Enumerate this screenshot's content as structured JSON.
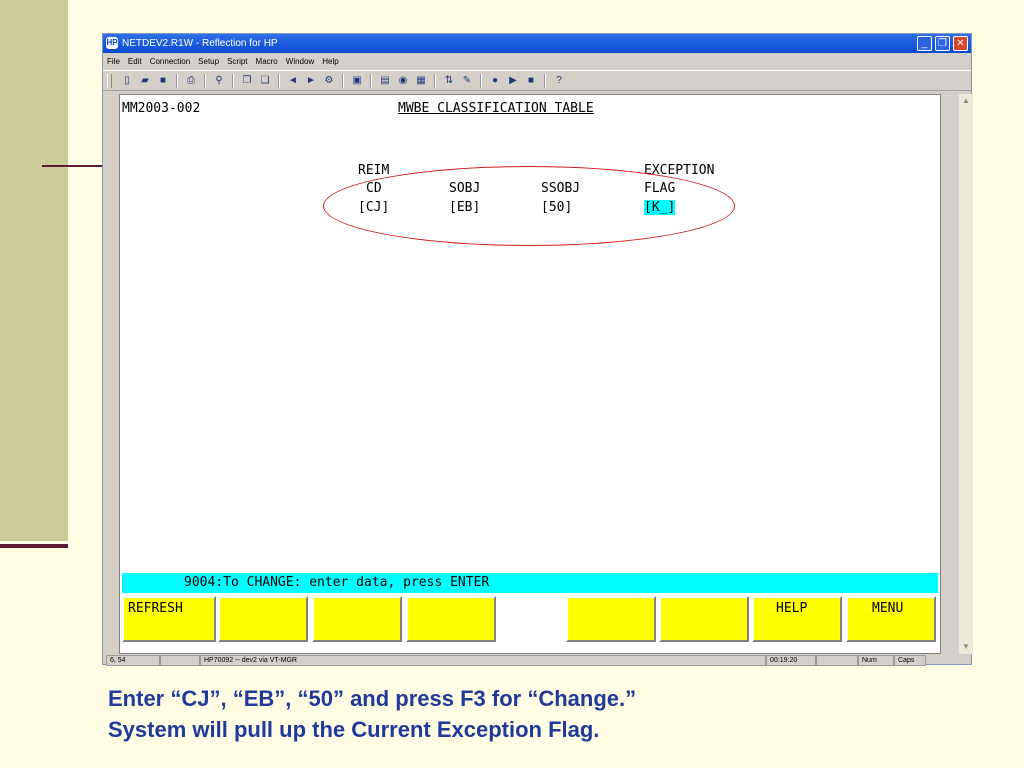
{
  "window": {
    "title": "NETDEV2.R1W - Reflection for HP",
    "app_icon": "HP",
    "min": "_",
    "max": "❐",
    "close": "✕"
  },
  "menu": [
    "File",
    "Edit",
    "Connection",
    "Setup",
    "Script",
    "Macro",
    "Window",
    "Help"
  ],
  "toolbar_icons": [
    "new-icon",
    "open-icon",
    "save-icon",
    "print-icon",
    "find-icon",
    "copy-icon",
    "paste-icon",
    "connect-icon",
    "disconnect-icon",
    "settings-icon",
    "terminal-icon",
    "display-icon",
    "color-icon",
    "keyboard-icon",
    "transfer-icon",
    "macro-icon",
    "record-icon",
    "play-icon",
    "stop-icon",
    "help-icon"
  ],
  "toolbar_glyphs": [
    "▯",
    "▰",
    "■",
    "⎙",
    "⚲",
    "❐",
    "❏",
    "◄",
    "►",
    "⚙",
    "▣",
    "▤",
    "◉",
    "▦",
    "⇅",
    "✎",
    "●",
    "▶",
    "■",
    "?"
  ],
  "terminal": {
    "screen_id": "MM2003-002",
    "title": "MWBE CLASSIFICATION TABLE",
    "headers_row1": {
      "reim": "REIM",
      "exception": "EXCEPTION"
    },
    "headers_row2": {
      "cd": "CD",
      "sobj": "SOBJ",
      "ssobj": "SSOBJ",
      "flag": "FLAG"
    },
    "values": {
      "cd": "[CJ]",
      "sobj": "[EB]",
      "ssobj": "[50]",
      "flag": "[K_]"
    },
    "message": "9004:To CHANGE: enter data, press ENTER",
    "fkeys": [
      "REFRESH",
      "",
      "",
      "",
      "",
      "",
      "",
      "HELP",
      "MENU"
    ],
    "highlight_color": "#00ffff",
    "fkey_color": "#ffff00"
  },
  "statusbar": {
    "cursor": "6, 54",
    "host": "HP70092 -- dev2 via VT-MGR",
    "time": "00:19:20",
    "num": "Num",
    "caps": "Caps"
  },
  "caption": {
    "line1": "Enter “CJ”, “EB”, “50” and press F3 for “Change.”",
    "line2": "System will pull up the Current Exception Flag."
  }
}
